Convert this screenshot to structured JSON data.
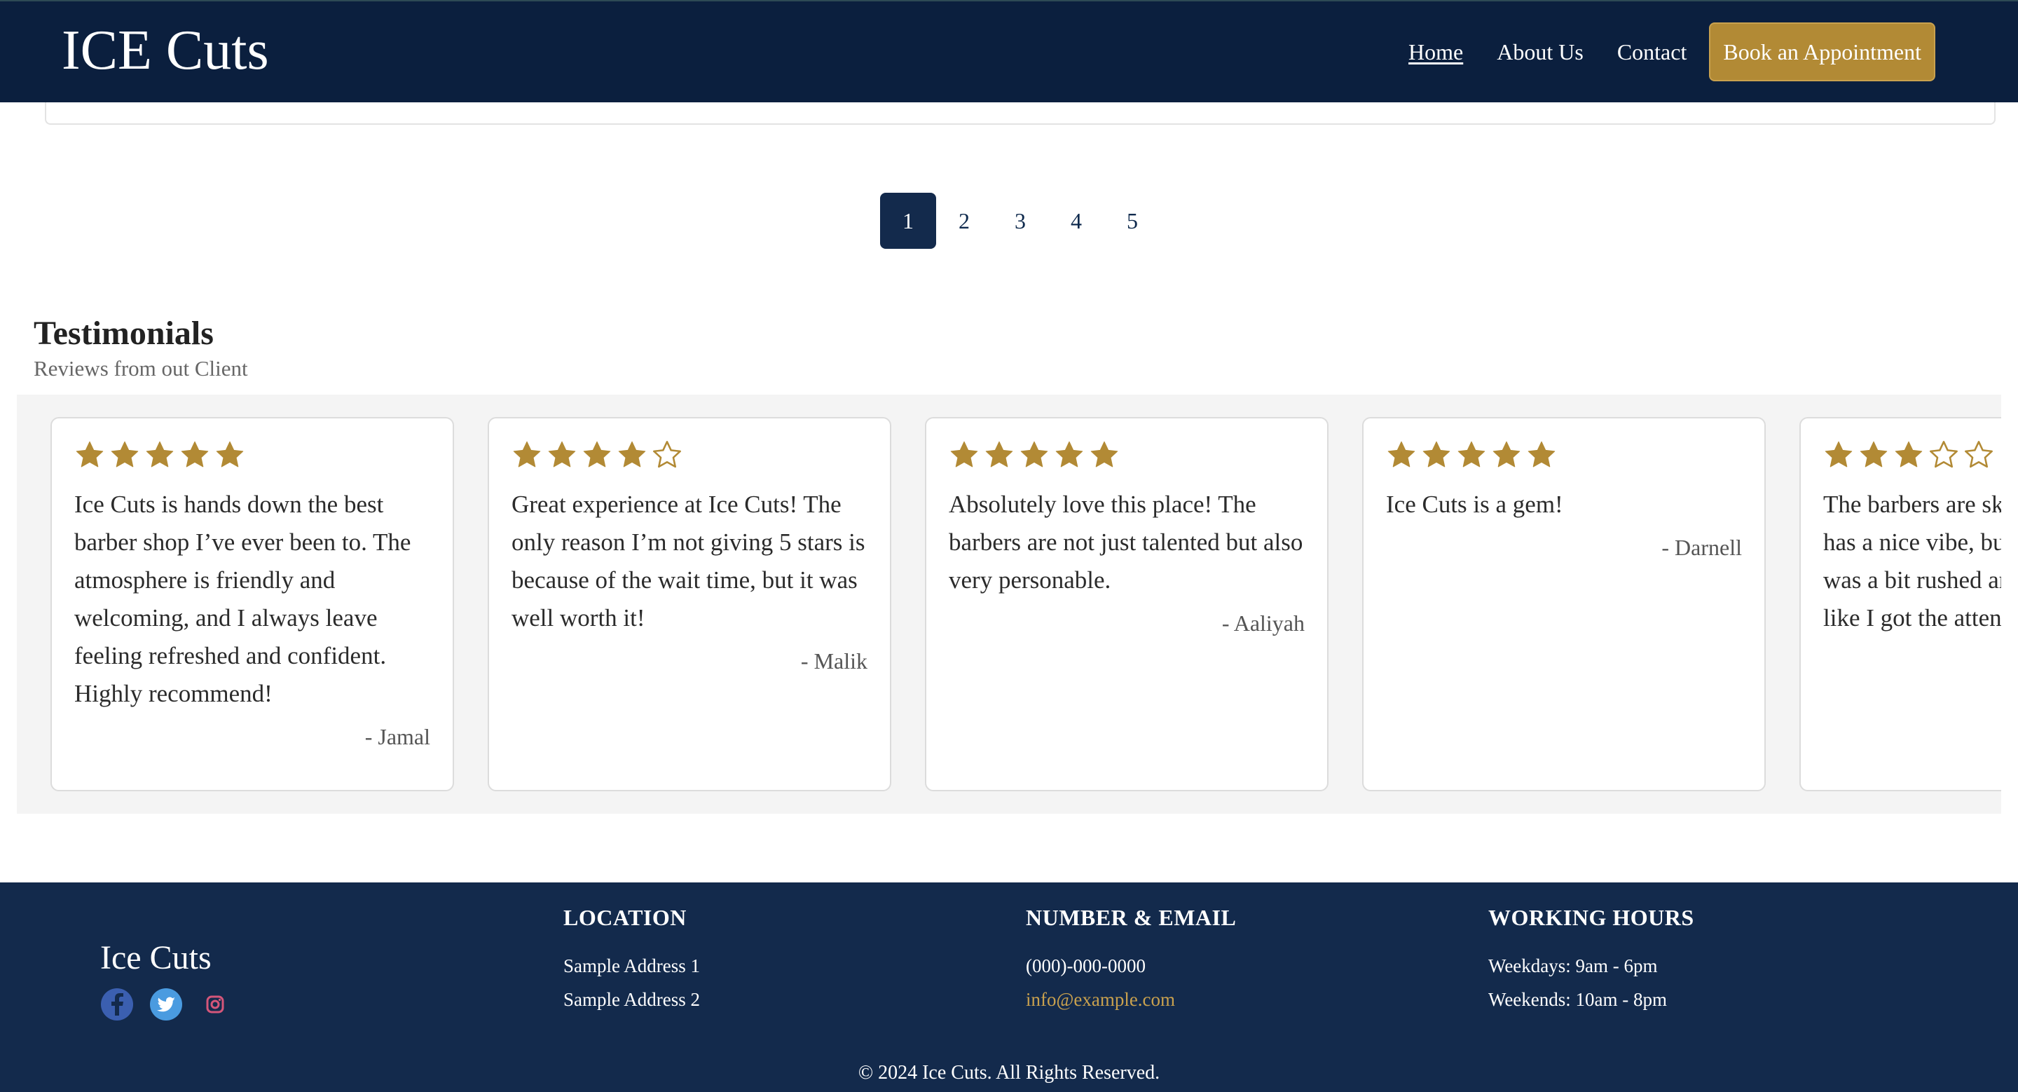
{
  "nav": {
    "brand": "ICE Cuts",
    "links": [
      "Home",
      "About Us",
      "Contact"
    ],
    "cta": "Book an Appointment"
  },
  "pagination": {
    "pages": [
      "1",
      "2",
      "3",
      "4",
      "5"
    ],
    "active": 1
  },
  "testimonials": {
    "title": "Testimonials",
    "subtitle": "Reviews from out Client",
    "items": [
      {
        "rating": 5,
        "text": "Ice Cuts is hands down the best barber shop I’ve ever been to. The atmosphere is friendly and welcoming, and I always leave feeling refreshed and confident. Highly recommend!",
        "author": "- Jamal"
      },
      {
        "rating": 4,
        "text": "Great experience at Ice Cuts! The only reason I’m not giving 5 stars is because of the wait time, but it was well worth it!",
        "author": "- Malik"
      },
      {
        "rating": 5,
        "text": "Absolutely love this place! The barbers are not just talented but also very personable.",
        "author": "- Aaliyah"
      },
      {
        "rating": 5,
        "text": "Ice Cuts is a gem!",
        "author": "- Darnell"
      },
      {
        "rating": 3,
        "text": "The barbers are skilled and the shop has a nice vibe, but my last visit was a bit rushed and I didn’t feel like I got the attention I usually",
        "author": ""
      }
    ]
  },
  "colors": {
    "navy": "#0b1f3e",
    "footer": "#132a4c",
    "gold": "#b28a35"
  },
  "footer": {
    "brand": "Ice Cuts",
    "social": [
      "facebook-icon",
      "twitter-icon",
      "instagram-icon"
    ],
    "location": {
      "heading": "LOCATION",
      "lines": [
        "Sample Address 1",
        "Sample Address 2"
      ]
    },
    "contact": {
      "heading": "NUMBER & EMAIL",
      "phone": "(000)-000-0000",
      "email": "info@example.com"
    },
    "hours": {
      "heading": "WORKING HOURS",
      "lines": [
        "Weekdays: 9am - 6pm",
        "Weekends: 10am - 8pm"
      ]
    },
    "copyright": "© 2024 Ice Cuts. All Rights Reserved."
  }
}
